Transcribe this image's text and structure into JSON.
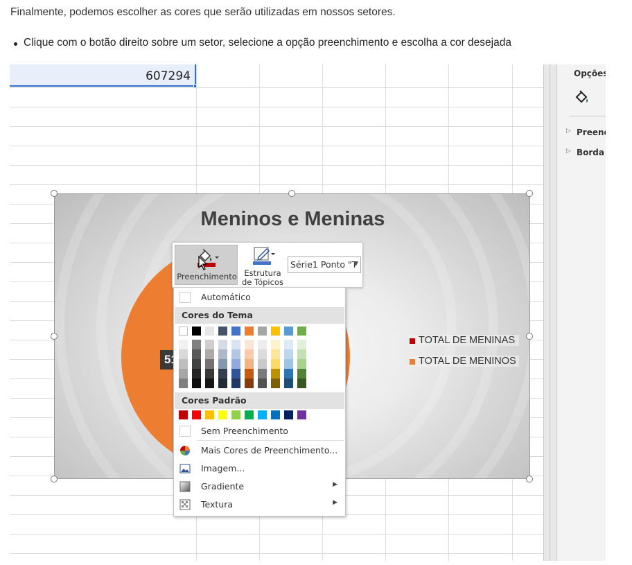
{
  "intro_text": "Finalmente, podemos escolher as cores que serão utilizadas em nossos setores.",
  "bullet_text": "Clique com o botão direito sobre um setor, selecione a opção preenchimento e escolha a cor desejada",
  "sheet": {
    "selected_cell_value": "607294"
  },
  "pane": {
    "title": "Opções",
    "items": [
      "Preenchimento",
      "Borda"
    ]
  },
  "chart": {
    "title": "Meninos e Meninas",
    "data_label": "51",
    "legend": [
      {
        "label": "TOTAL DE MENINAS",
        "color": "#c00000"
      },
      {
        "label": "TOTAL DE MENINOS",
        "color": "#ed7d31"
      }
    ],
    "pie_color": "#ed7d31"
  },
  "minibar": {
    "fill_label": "Preenchimento",
    "outline_label_1": "Estrutura",
    "outline_label_2": "de Tópicos",
    "element_select": "Série1 Ponto \"T"
  },
  "menu": {
    "automatic": "Automático",
    "theme_header": "Cores do Tema",
    "theme_colors": [
      "#ffffff",
      "#000000",
      "#e7e6e6",
      "#44546a",
      "#4472c4",
      "#ed7d31",
      "#a5a5a5",
      "#ffc000",
      "#5b9bd5",
      "#70ad47"
    ],
    "theme_shades": [
      [
        "#f2f2f2",
        "#d9d9d9",
        "#bfbfbf",
        "#a6a6a6",
        "#808080"
      ],
      [
        "#808080",
        "#595959",
        "#404040",
        "#262626",
        "#0d0d0d"
      ],
      [
        "#d0cece",
        "#aeaaaa",
        "#757171",
        "#3a3838",
        "#171616"
      ],
      [
        "#d6dce5",
        "#adb9ca",
        "#8497b0",
        "#333f50",
        "#222a35"
      ],
      [
        "#dae3f3",
        "#b4c7e7",
        "#8faadc",
        "#2f5597",
        "#203864"
      ],
      [
        "#fbe5d6",
        "#f8cbad",
        "#f4b183",
        "#c55a11",
        "#843c0c"
      ],
      [
        "#ededed",
        "#dbdbdb",
        "#c9c9c9",
        "#7b7b7b",
        "#525252"
      ],
      [
        "#fff2cc",
        "#ffe699",
        "#ffd966",
        "#bf9000",
        "#7f6000"
      ],
      [
        "#deebf7",
        "#bdd7ee",
        "#9dc3e6",
        "#2e75b6",
        "#1f4e79"
      ],
      [
        "#e2f0d9",
        "#c5e0b4",
        "#a9d18e",
        "#538135",
        "#385723"
      ]
    ],
    "standard_header": "Cores Padrão",
    "standard_colors": [
      "#c00000",
      "#ff0000",
      "#ffc000",
      "#ffff00",
      "#92d050",
      "#00b050",
      "#00b0f0",
      "#0070c0",
      "#002060",
      "#7030a0"
    ],
    "no_fill": "Sem Preenchimento",
    "more_colors": "Mais Cores de Preenchimento...",
    "picture": "Imagem...",
    "gradient": "Gradiente",
    "texture": "Textura"
  }
}
